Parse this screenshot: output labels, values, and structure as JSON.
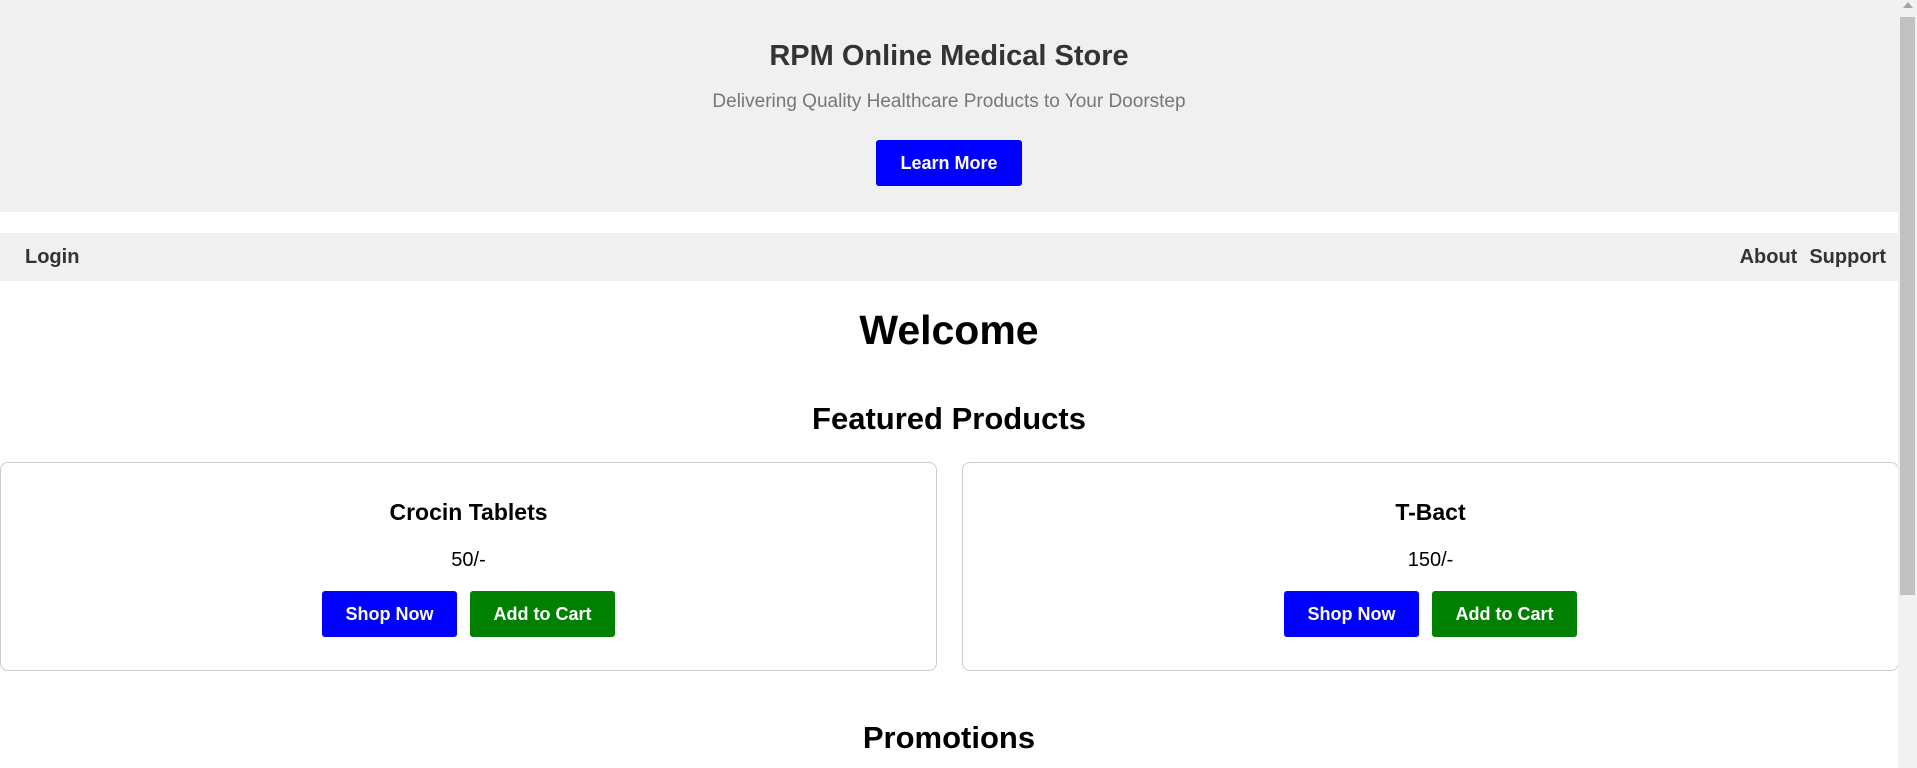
{
  "hero": {
    "title": "RPM Online Medical Store",
    "subtitle": "Delivering Quality Healthcare Products to Your Doorstep",
    "button_label": "Learn More"
  },
  "nav": {
    "left": "Login",
    "right": [
      "About",
      "Support"
    ]
  },
  "main": {
    "welcome": "Welcome",
    "featured_heading": "Featured Products",
    "promotions_heading": "Promotions"
  },
  "products": [
    {
      "name": "Crocin Tablets",
      "price": "50/-",
      "shop_label": "Shop Now",
      "cart_label": "Add to Cart"
    },
    {
      "name": "T-Bact",
      "price": "150/-",
      "shop_label": "Shop Now",
      "cart_label": "Add to Cart"
    }
  ],
  "colors": {
    "primary_button": "#0000ff",
    "cart_button": "#008000",
    "header_bg": "#f0f0f0"
  },
  "icons": {
    "scroll_up": "scroll-up-arrow-icon"
  }
}
